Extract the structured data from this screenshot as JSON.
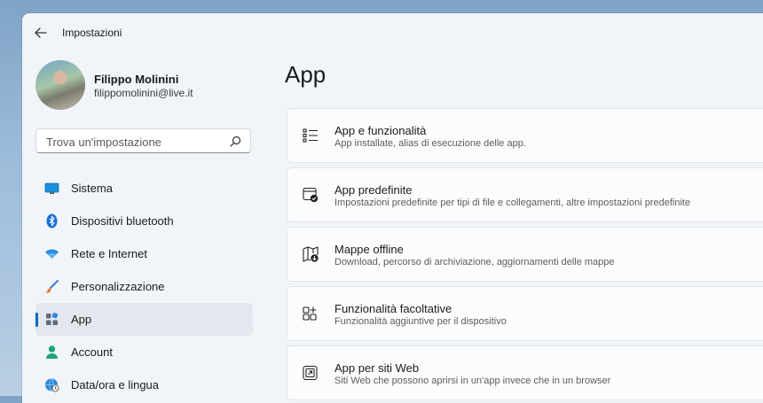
{
  "window": {
    "title": "Impostazioni"
  },
  "user": {
    "name": "Filippo Molinini",
    "email": "filippomolinini@live.it"
  },
  "search": {
    "placeholder": "Trova un'impostazione"
  },
  "sidebar": {
    "items": [
      {
        "label": "Sistema",
        "icon": "monitor-icon",
        "active": false
      },
      {
        "label": "Dispositivi bluetooth",
        "icon": "bluetooth-icon",
        "active": false
      },
      {
        "label": "Rete e Internet",
        "icon": "wifi-icon",
        "active": false
      },
      {
        "label": "Personalizzazione",
        "icon": "brush-icon",
        "active": false
      },
      {
        "label": "App",
        "icon": "apps-icon",
        "active": true
      },
      {
        "label": "Account",
        "icon": "person-icon",
        "active": false
      },
      {
        "label": "Data/ora e lingua",
        "icon": "globe-clock-icon",
        "active": false
      }
    ]
  },
  "main": {
    "title": "App",
    "cards": [
      {
        "title": "App e funzionalità",
        "subtitle": "App installate, alias di esecuzione delle app.",
        "icon": "list-icon"
      },
      {
        "title": "App predefinite",
        "subtitle": "Impostazioni predefinite per tipi di file e collegamenti, altre impostazioni predefinite",
        "icon": "default-apps-icon"
      },
      {
        "title": "Mappe offline",
        "subtitle": "Download, percorso di archiviazione, aggiornamenti delle mappe",
        "icon": "map-download-icon"
      },
      {
        "title": "Funzionalità facoltative",
        "subtitle": "Funzionalità aggiuntive per il dispositivo",
        "icon": "grid-add-icon"
      },
      {
        "title": "App per siti Web",
        "subtitle": "Siti Web che possono aprirsi in un'app invece che in un browser",
        "icon": "open-in-app-icon"
      }
    ]
  },
  "colors": {
    "accent": "#0067c0",
    "window_bg": "#f1f4f9",
    "card_bg": "#fbfcfd"
  }
}
